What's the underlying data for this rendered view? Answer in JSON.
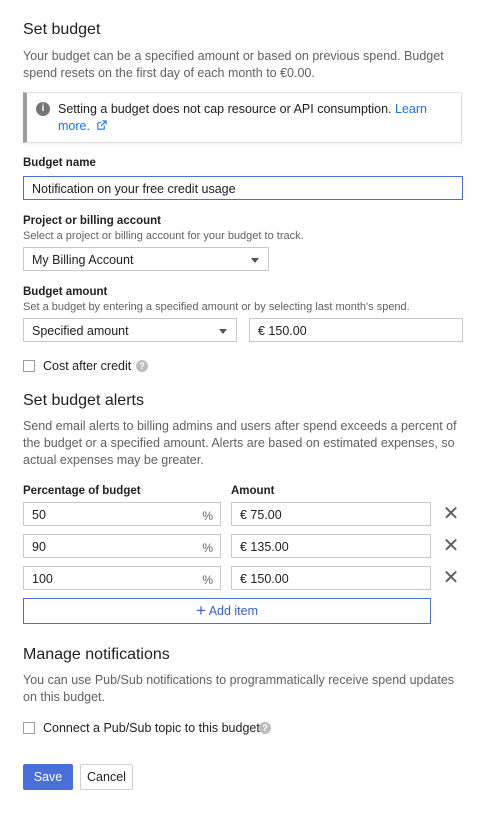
{
  "set_budget": {
    "title": "Set budget",
    "description": "Your budget can be a specified amount or based on previous spend. Budget spend resets on the first day of each month to €0.00.",
    "info_text": "Setting a budget does not cap resource or API consumption.",
    "info_link": "Learn more.",
    "info_icon": "info-icon",
    "external_icon": "external-link-icon",
    "budget_name_label": "Budget name",
    "budget_name_value": "Notification on your free credit usage",
    "project_label": "Project or billing account",
    "project_sub": "Select a project or billing account for your budget to track.",
    "project_value": "My Billing Account",
    "amount_label": "Budget amount",
    "amount_sub": "Set a budget by entering a specified amount or by selecting last month's spend.",
    "amount_type_value": "Specified amount",
    "amount_value": "€  150.00",
    "cost_after_credit_label": "Cost after credit"
  },
  "alerts": {
    "title": "Set budget alerts",
    "description": "Send email alerts to billing admins and users after spend exceeds a percent of the budget or a specified amount. Alerts are based on estimated expenses, so actual expenses may be greater.",
    "col_percentage": "Percentage of budget",
    "col_amount": "Amount",
    "rows": [
      {
        "percent": "50",
        "amount": "€  75.00"
      },
      {
        "percent": "90",
        "amount": "€  135.00"
      },
      {
        "percent": "100",
        "amount": "€  150.00"
      }
    ],
    "percent_sign": "%",
    "remove_symbol": "✕",
    "add_item_label": "Add item",
    "add_icon": "+"
  },
  "notifications": {
    "title": "Manage notifications",
    "description": "You can use Pub/Sub notifications to programmatically receive spend updates on this budget.",
    "pubsub_label": "Connect a Pub/Sub topic to this budget"
  },
  "actions": {
    "save": "Save",
    "cancel": "Cancel"
  },
  "colors": {
    "accent": "#4a6fd8",
    "link": "#1a73e8"
  }
}
